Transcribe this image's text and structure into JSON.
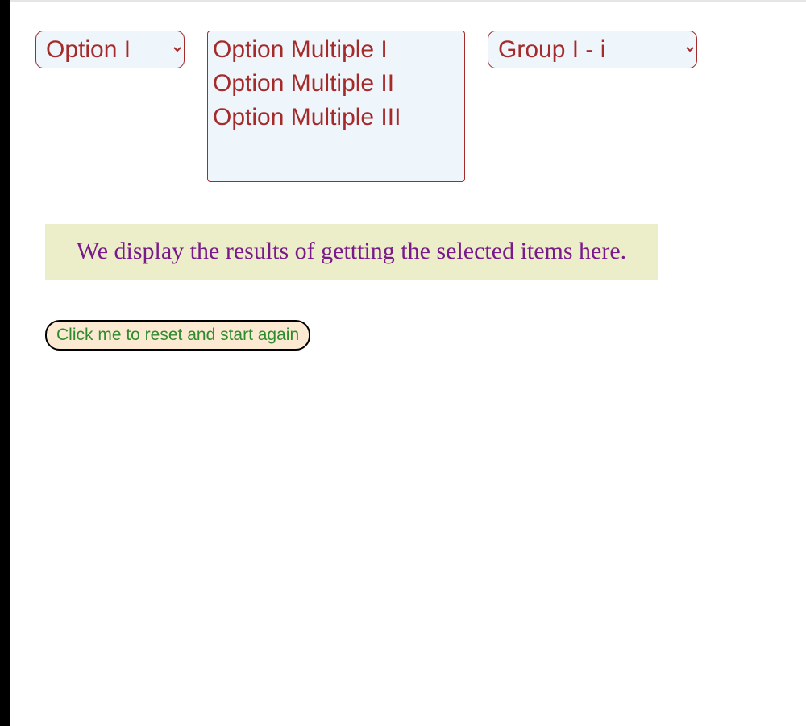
{
  "selects": {
    "single": {
      "selected": "Option I",
      "options": [
        "Option I"
      ]
    },
    "multiple": {
      "options": [
        "Option Multiple I",
        "Option Multiple II",
        "Option Multiple III"
      ]
    },
    "group": {
      "selected": "Group I - i",
      "options": [
        "Group I - i"
      ]
    }
  },
  "results": {
    "text": "We display the results of gettting the selected items here."
  },
  "buttons": {
    "reset_label": "Click me to reset and start again"
  }
}
